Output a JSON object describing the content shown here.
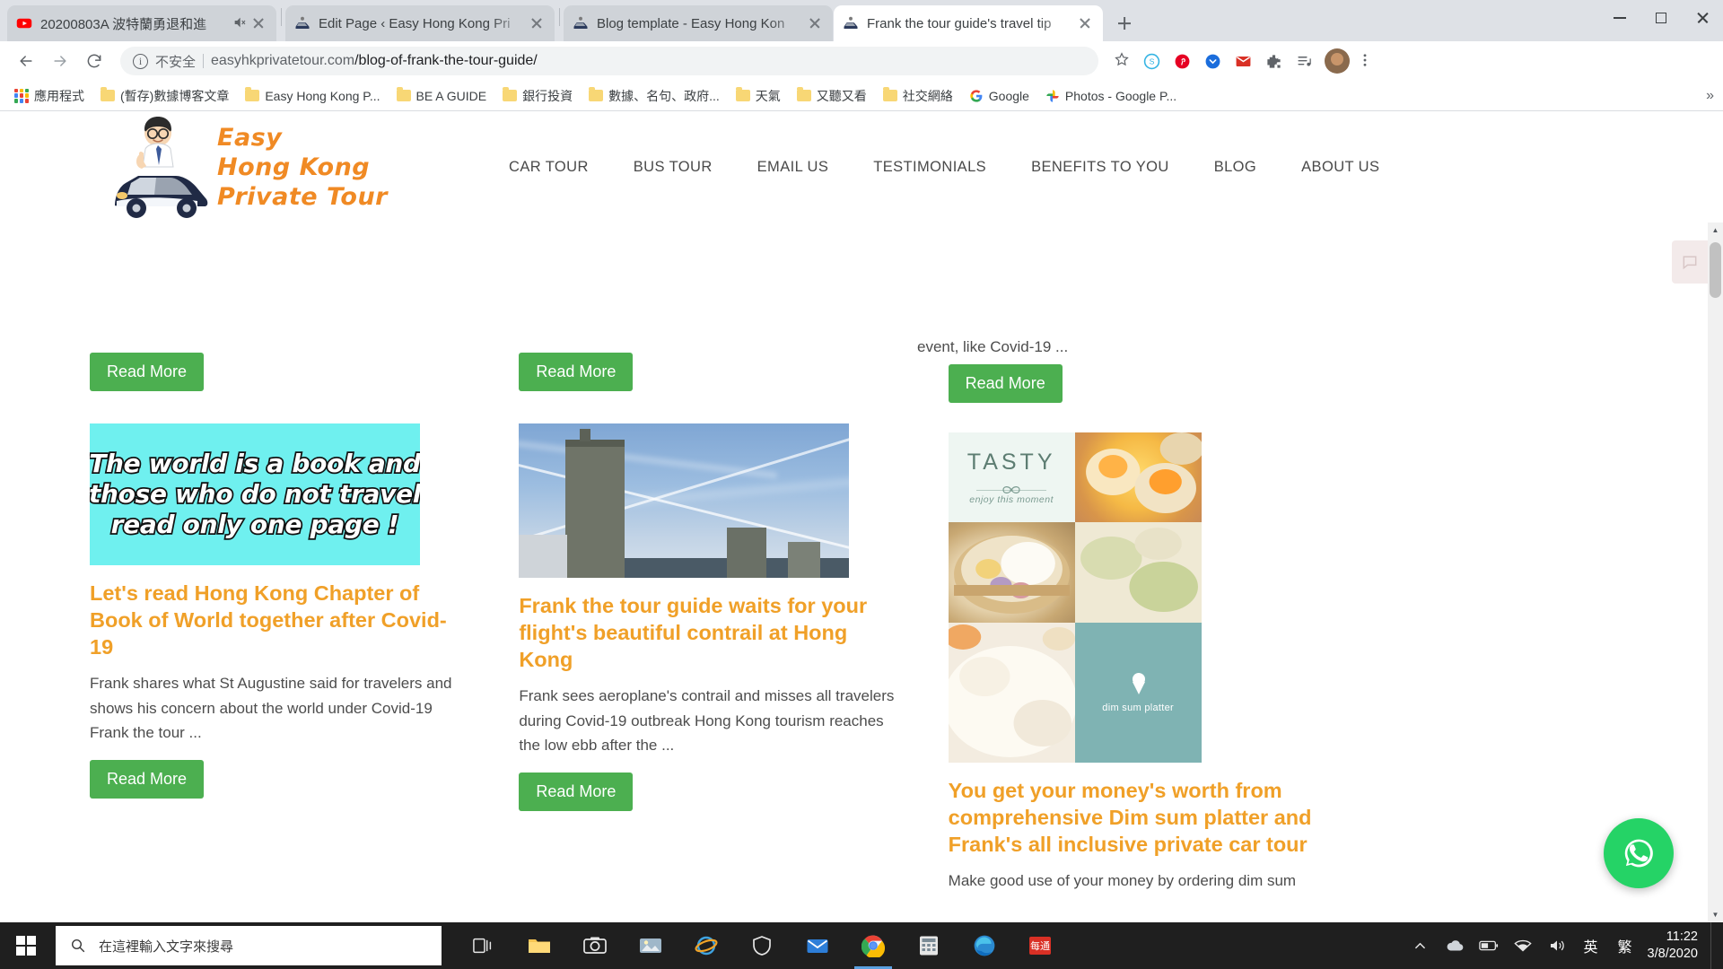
{
  "browser": {
    "tabs": [
      {
        "title": "20200803A 波特蘭勇退和進",
        "favicon": "youtube-icon",
        "muted": true,
        "active": false
      },
      {
        "title": "Edit Page ‹ Easy Hong Kong Pri",
        "favicon": "site-icon",
        "muted": false,
        "active": false
      },
      {
        "title": "Blog template - Easy Hong Kon",
        "favicon": "site-icon",
        "muted": false,
        "active": false
      },
      {
        "title": "Frank the tour guide's travel tip",
        "favicon": "site-icon",
        "muted": false,
        "active": true
      }
    ],
    "new_tab_label": "+",
    "window_controls": {
      "minimize": "minimize-icon",
      "maximize": "maximize-icon",
      "close": "close-icon"
    },
    "toolbar": {
      "back": "back-arrow-icon",
      "forward": "forward-arrow-icon",
      "reload": "reload-icon",
      "security_label": "不安全",
      "url_host": "easyhkprivatetour.com",
      "url_path": "/blog-of-frank-the-tour-guide/",
      "url_full": "easyhkprivatetour.com/blog-of-frank-the-tour-guide/",
      "bookmark_star": "star-icon",
      "extensions": [
        "skype-icon",
        "pinterest-icon",
        "pocket-icon",
        "gmail-icon",
        "puzzle-extension-icon",
        "music-list-icon"
      ],
      "profile": "avatar",
      "menu": "three-dot-menu-icon"
    },
    "bookmarks": [
      {
        "label": "應用程式",
        "icon": "apps-grid-icon"
      },
      {
        "label": "(暫存)數據博客文章",
        "icon": "folder-icon"
      },
      {
        "label": "Easy Hong Kong P...",
        "icon": "folder-icon"
      },
      {
        "label": "BE A GUIDE",
        "icon": "folder-icon"
      },
      {
        "label": "銀行投資",
        "icon": "folder-icon"
      },
      {
        "label": "數據、名句、政府...",
        "icon": "folder-icon"
      },
      {
        "label": "天氣",
        "icon": "folder-icon"
      },
      {
        "label": "又聽又看",
        "icon": "folder-icon"
      },
      {
        "label": "社交網絡",
        "icon": "folder-icon"
      },
      {
        "label": "Google",
        "icon": "google-icon"
      },
      {
        "label": "Photos - Google P...",
        "icon": "google-photos-icon"
      }
    ],
    "bookmarks_overflow": "»"
  },
  "site": {
    "logo": {
      "line1": "Easy",
      "line2": "Hong Kong",
      "line3": "Private Tour",
      "color": "#f08a24"
    },
    "nav": [
      {
        "label": "CAR TOUR"
      },
      {
        "label": "BUS TOUR"
      },
      {
        "label": "EMAIL US"
      },
      {
        "label": "TESTIMONIALS"
      },
      {
        "label": "BENEFITS TO YOU"
      },
      {
        "label": "BLOG"
      },
      {
        "label": "ABOUT US"
      }
    ],
    "read_more_label": "Read More",
    "accent_color": "#f0a028",
    "button_color": "#4caf50",
    "top_row": [
      {
        "read_more": "Read More"
      },
      {
        "read_more": "Read More"
      },
      {
        "partial_excerpt": "event, like Covid-19 ...",
        "read_more": "Read More"
      }
    ],
    "posts": [
      {
        "image": {
          "type": "quote-graphic",
          "background": "#6ff0ef",
          "lines": [
            "The world is a book and",
            "those who do not travel",
            "read only one page !"
          ]
        },
        "title": "Let's read Hong Kong Chapter of Book of World together after Covid-19",
        "excerpt": "Frank shares what St Augustine said for travelers and shows his concern about the world under Covid-19 Frank the tour ...",
        "read_more": "Read More"
      },
      {
        "image": {
          "type": "photo",
          "description": "building-and-sky-with-contrail-photo"
        },
        "title": "Frank the tour guide waits for your flight's beautiful contrail at Hong Kong",
        "excerpt": "Frank sees aeroplane's contrail and misses all travelers during Covid-19 outbreak Hong Kong tourism reaches the low ebb after the ...",
        "read_more": "Read More"
      },
      {
        "image": {
          "type": "collage",
          "brand": "TASTY",
          "tagline": "enjoy this moment",
          "caption": "dim sum platter"
        },
        "title": "You get your money's worth from comprehensive Dim sum platter and Frank's all inclusive private car tour",
        "excerpt": "Make good use of your money by ordering dim sum"
      }
    ],
    "whatsapp_fab": "whatsapp-icon"
  },
  "taskbar": {
    "start": "windows-start-icon",
    "search_placeholder": "在這裡輸入文字來搜尋",
    "apps": [
      "task-view-icon",
      "file-explorer-icon",
      "camera-icon",
      "photos-icon",
      "internet-explorer-icon",
      "windows-defender-icon",
      "mail-icon",
      "chrome-icon",
      "calculator-icon",
      "edge-icon",
      "news-app-icon"
    ],
    "tray": [
      "show-hidden-icons-icon",
      "onedrive-icon",
      "battery-icon",
      "network-icon",
      "volume-icon"
    ],
    "ime_language": "英",
    "ime_mode": "繁",
    "time": "11:22",
    "date": "3/8/2020"
  }
}
